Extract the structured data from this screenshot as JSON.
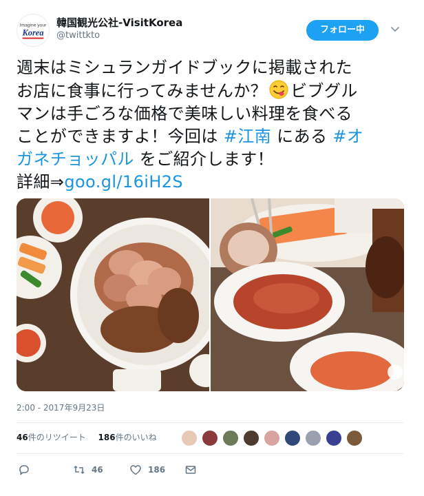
{
  "author": {
    "display_name": "韓国観光公社-VisitKorea",
    "handle": "@twittkto",
    "avatar_text_top": "Imagine your",
    "avatar_text_logo": "Korea"
  },
  "follow_button": {
    "label": "フォロー中"
  },
  "tweet": {
    "line1": "週末はミシュランガイドブックに掲載された",
    "line2_a": "お店に食事に行ってみませんか？",
    "line2_b": "ビブグル",
    "line3": "マンは手ごろな価格で美味しい料理を食べる",
    "line4_a": "ことができますよ！今回は ",
    "hashtag1": "#江南",
    "line4_b": " にある ",
    "hashtag2_part1": "#オ",
    "hashtag2_part2": "ガネチョッパル",
    "line5_b": " をご紹介します！",
    "line6_a": "詳細⇒",
    "url": "goo.gl/16iH2S"
  },
  "timestamp": "2:00 - 2017年9月23日",
  "stats": {
    "retweets_count": "46",
    "retweets_label": "件のリツイート",
    "likes_count": "186",
    "likes_label": "件のいいね"
  },
  "actions": {
    "reply_icon": "reply-icon",
    "retweet_icon": "retweet-icon",
    "retweet_count": "46",
    "like_icon": "heart-icon",
    "like_count": "186",
    "dm_icon": "envelope-icon"
  },
  "colors": {
    "accent": "#1da1f2",
    "link": "#1b95e0",
    "secondary_text": "#657786",
    "border": "#e6ecf0"
  }
}
